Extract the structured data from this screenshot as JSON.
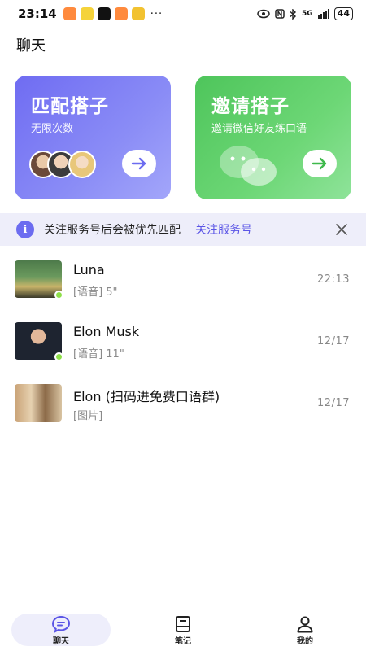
{
  "status_bar": {
    "time": "23:14",
    "more": "···",
    "network": "5G",
    "battery": "44"
  },
  "header": {
    "title": "聊天"
  },
  "cards": {
    "match": {
      "title": "匹配搭子",
      "subtitle": "无限次数"
    },
    "invite": {
      "title": "邀请搭子",
      "subtitle": "邀请微信好友练口语"
    }
  },
  "notice": {
    "text": "关注服务号后会被优先匹配",
    "link": "关注服务号"
  },
  "chats": [
    {
      "name": "Luna",
      "preview": "[语音] 5\"",
      "time": "22:13",
      "online": true
    },
    {
      "name": "Elon Musk",
      "preview": "[语音] 11\"",
      "time": "12/17",
      "online": true
    },
    {
      "name": "Elon (扫码进免费口语群)",
      "preview": "[图片]",
      "time": "12/17",
      "online": false
    }
  ],
  "nav": {
    "items": [
      {
        "label": "聊天",
        "icon": "chat-bubble-icon",
        "active": true
      },
      {
        "label": "笔记",
        "icon": "notebook-icon",
        "active": false
      },
      {
        "label": "我的",
        "icon": "person-icon",
        "active": false
      }
    ]
  },
  "colors": {
    "accent": "#6c6cf0",
    "match_card": "#7b78f4",
    "invite_card": "#5acb64",
    "online": "#8ee04a"
  }
}
